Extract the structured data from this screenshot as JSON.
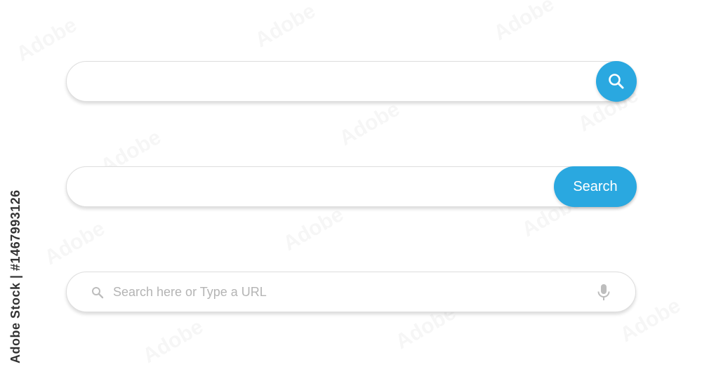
{
  "bars": {
    "icon_button": {
      "input_value": "",
      "icon": "search-icon"
    },
    "text_button": {
      "input_value": "",
      "button_label": "Search"
    },
    "url_bar": {
      "placeholder": "Search here or Type a URL",
      "leading_icon": "search-icon",
      "trailing_icon": "microphone-icon"
    }
  },
  "side_credit": "Adobe Stock | #1467993126",
  "colors": {
    "accent": "#2aa8e0",
    "bar_border": "#dedede",
    "placeholder": "#b4b4b4",
    "icon_gray": "#bdbdbd"
  }
}
